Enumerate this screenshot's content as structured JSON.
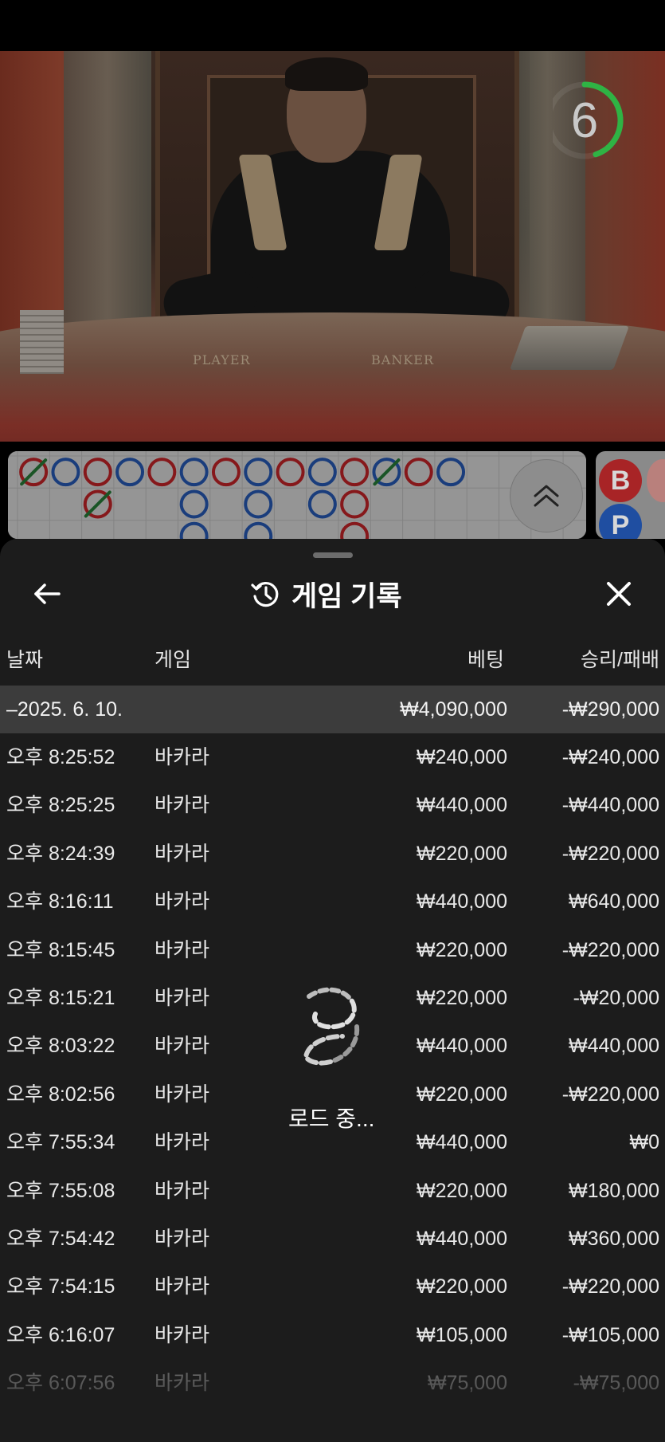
{
  "video": {
    "countdown": "6",
    "countdown_progress": 0.45,
    "table_labels": {
      "player": "PLAYER",
      "banker": "BANKER"
    }
  },
  "roadmap": {
    "columns": [
      [
        "banker-tie",
        "",
        ""
      ],
      [
        "player",
        "",
        ""
      ],
      [
        "banker",
        "banker-tie",
        ""
      ],
      [
        "player",
        "",
        ""
      ],
      [
        "banker",
        "",
        ""
      ],
      [
        "player",
        "player",
        "player"
      ],
      [
        "banker",
        "",
        ""
      ],
      [
        "player",
        "player",
        "player"
      ],
      [
        "banker",
        "",
        ""
      ],
      [
        "player",
        "player",
        ""
      ],
      [
        "banker",
        "banker",
        "banker"
      ],
      [
        "player-tie",
        "",
        ""
      ],
      [
        "banker",
        "",
        ""
      ],
      [
        "player",
        "",
        ""
      ]
    ],
    "bead_labels": {
      "banker": "B",
      "player": "P"
    },
    "expand_icon": "chevron-double-up-icon"
  },
  "sheet": {
    "title": "게임 기록",
    "title_icon": "history-icon",
    "back_icon": "arrow-left-icon",
    "close_icon": "close-icon",
    "columns": {
      "date": "날짜",
      "game": "게임",
      "bet": "베팅",
      "result": "승리/패배"
    },
    "date_group": {
      "date": "–2025. 6. 10.",
      "bet": "₩4,090,000",
      "result": "-₩290,000"
    },
    "rows": [
      {
        "time": "오후 8:25:52",
        "game": "바카라",
        "bet": "₩240,000",
        "result": "-₩240,000"
      },
      {
        "time": "오후 8:25:25",
        "game": "바카라",
        "bet": "₩440,000",
        "result": "-₩440,000"
      },
      {
        "time": "오후 8:24:39",
        "game": "바카라",
        "bet": "₩220,000",
        "result": "-₩220,000"
      },
      {
        "time": "오후 8:16:11",
        "game": "바카라",
        "bet": "₩440,000",
        "result": "₩640,000"
      },
      {
        "time": "오후 8:15:45",
        "game": "바카라",
        "bet": "₩220,000",
        "result": "-₩220,000"
      },
      {
        "time": "오후 8:15:21",
        "game": "바카라",
        "bet": "₩220,000",
        "result": "-₩20,000"
      },
      {
        "time": "오후 8:03:22",
        "game": "바카라",
        "bet": "₩440,000",
        "result": "₩440,000"
      },
      {
        "time": "오후 8:02:56",
        "game": "바카라",
        "bet": "₩220,000",
        "result": "-₩220,000"
      },
      {
        "time": "오후 7:55:34",
        "game": "바카라",
        "bet": "₩440,000",
        "result": "₩0"
      },
      {
        "time": "오후 7:55:08",
        "game": "바카라",
        "bet": "₩220,000",
        "result": "₩180,000"
      },
      {
        "time": "오후 7:54:42",
        "game": "바카라",
        "bet": "₩440,000",
        "result": "₩360,000"
      },
      {
        "time": "오후 7:54:15",
        "game": "바카라",
        "bet": "₩220,000",
        "result": "-₩220,000"
      },
      {
        "time": "오후 6:16:07",
        "game": "바카라",
        "bet": "₩105,000",
        "result": "-₩105,000"
      },
      {
        "time": "오후 6:07:56",
        "game": "바카라",
        "bet": "₩75,000",
        "result": "-₩75,000"
      }
    ],
    "loading_text": "로드 중..."
  },
  "colors": {
    "banker": "#d8282c",
    "player": "#2a63c9",
    "tie": "#2b8a3e",
    "timer": "#2fb344",
    "sheet_bg": "#1c1c1c",
    "date_row_bg": "#3c3c3c"
  }
}
